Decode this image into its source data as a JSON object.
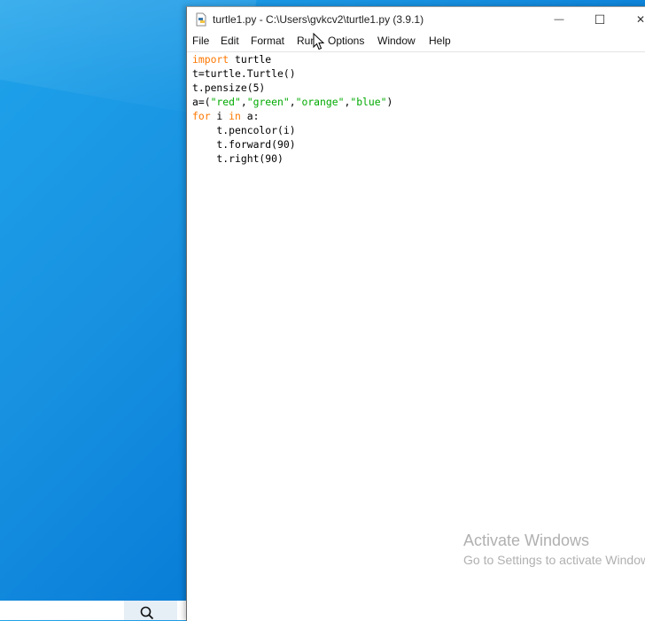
{
  "window": {
    "title": "turtle1.py - C:\\Users\\gvkcv2\\turtle1.py (3.9.1)",
    "controls": {
      "minimize": "—",
      "maximize": "☐",
      "close": "✕"
    }
  },
  "menu": [
    {
      "label": "File"
    },
    {
      "label": "Edit"
    },
    {
      "label": "Format"
    },
    {
      "label": "Run"
    },
    {
      "label": "Options"
    },
    {
      "label": "Window"
    },
    {
      "label": "Help"
    }
  ],
  "code": [
    {
      "segments": [
        {
          "t": "import",
          "c": "kw"
        },
        {
          "t": " turtle",
          "c": ""
        }
      ]
    },
    {
      "segments": [
        {
          "t": "t=turtle.Turtle()",
          "c": ""
        }
      ]
    },
    {
      "segments": [
        {
          "t": "t.pensize(5)",
          "c": ""
        }
      ]
    },
    {
      "segments": [
        {
          "t": "a=(",
          "c": ""
        },
        {
          "t": "\"red\"",
          "c": "str"
        },
        {
          "t": ",",
          "c": ""
        },
        {
          "t": "\"green\"",
          "c": "str"
        },
        {
          "t": ",",
          "c": ""
        },
        {
          "t": "\"orange\"",
          "c": "str"
        },
        {
          "t": ",",
          "c": ""
        },
        {
          "t": "\"blue\"",
          "c": "str"
        },
        {
          "t": ")",
          "c": ""
        }
      ]
    },
    {
      "segments": [
        {
          "t": "for",
          "c": "kw"
        },
        {
          "t": " i ",
          "c": ""
        },
        {
          "t": "in",
          "c": "kw"
        },
        {
          "t": " a:",
          "c": ""
        }
      ]
    },
    {
      "segments": [
        {
          "t": "    t.pencolor(i)",
          "c": ""
        }
      ]
    },
    {
      "segments": [
        {
          "t": "    t.forward(90)",
          "c": ""
        }
      ]
    },
    {
      "segments": [
        {
          "t": "    t.right(90)",
          "c": ""
        }
      ]
    }
  ],
  "watermark": {
    "title": "Activate Windows",
    "subtitle": "Go to Settings to activate Windows."
  },
  "colors": {
    "keyword": "#ff7700",
    "string": "#00aa00",
    "desktop": "#1790e0"
  }
}
